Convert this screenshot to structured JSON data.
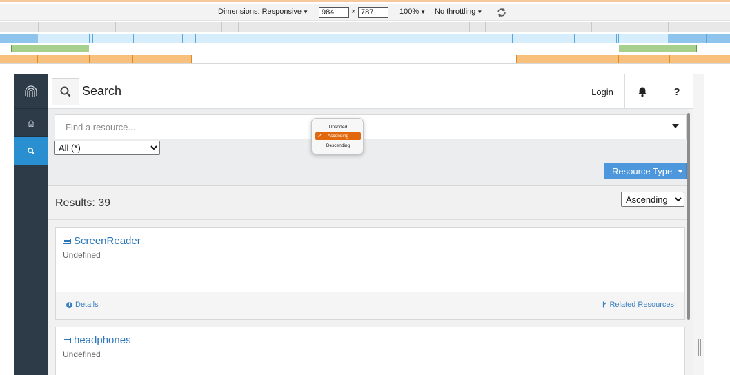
{
  "devtools": {
    "dimensions_label": "Dimensions: Responsive",
    "width_value": "984",
    "times": "×",
    "height_value": "787",
    "zoom": "100%",
    "throttling": "No throttling",
    "rotate_icon": "rotate-icon"
  },
  "sidebar": {
    "logo_icon": "fingerprint-logo-icon",
    "home_icon": "home-icon",
    "search_icon": "search-icon",
    "active_color": "#2a8fd0",
    "bg_color": "#2d3a48"
  },
  "header": {
    "title": "Search",
    "login_label": "Login",
    "bell_icon": "bell-icon",
    "help_label": "?"
  },
  "filters": {
    "resource_placeholder": "Find a resource...",
    "scope_value": "All (*)",
    "resource_type_label": "Resource Type",
    "resource_type_color": "#4d97dc"
  },
  "sort_popup": {
    "options": [
      "Unsorted",
      "Ascending",
      "Descending"
    ],
    "selected": "Ascending",
    "selected_color": "#e2680d"
  },
  "results": {
    "count_label": "Results: 39",
    "sort_value": "Ascending"
  },
  "cards": [
    {
      "title": "ScreenReader",
      "subtitle": "Undefined",
      "details_label": "Details",
      "related_label": "Related Resources"
    },
    {
      "title": "headphones",
      "subtitle": "Undefined"
    }
  ]
}
